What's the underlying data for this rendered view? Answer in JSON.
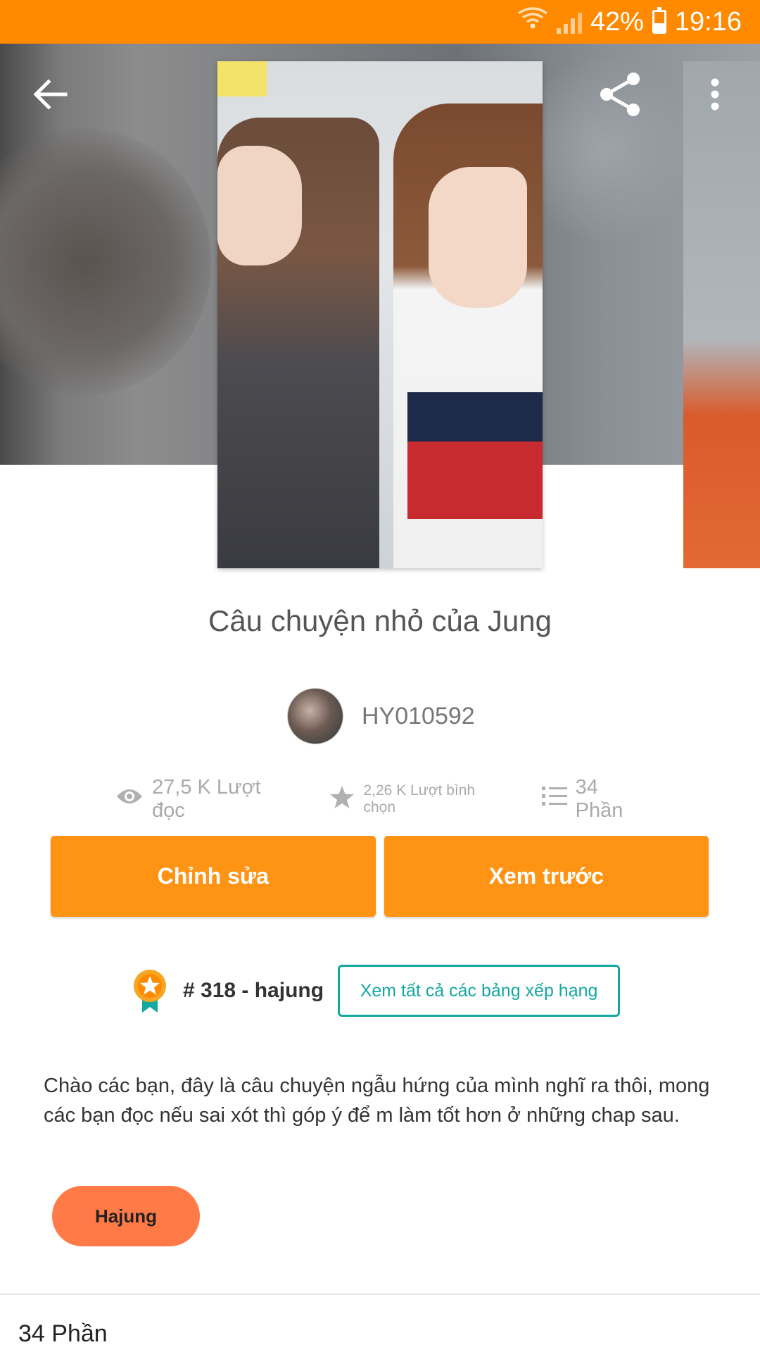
{
  "status_bar": {
    "battery": "42%",
    "time": "19:16",
    "battery_level": 0.42
  },
  "header": {
    "back_icon": "arrow-left-icon",
    "share_icon": "share-icon",
    "more_icon": "more-vert-icon"
  },
  "story": {
    "title": "Câu chuyện nhỏ của Jung",
    "author": "HY010592",
    "reads": "27,5 K Lượt đọc",
    "votes": "2,26 K Lượt bình chọn",
    "parts": "34 Phần",
    "description": "Chào các bạn, đây là câu chuyện ngẫu hứng của mình nghĩ ra thôi, mong các bạn đọc nếu sai xót thì góp ý để m làm tốt hơn ở những chap sau."
  },
  "actions": {
    "edit_label": "Chỉnh sửa",
    "preview_label": "Xem trước"
  },
  "ranking": {
    "rank_text": "# 318 - hajung",
    "view_all_label": "Xem tất cả các bảng xếp hạng"
  },
  "tags": [
    {
      "label": "Hajung"
    }
  ],
  "parts_section": {
    "heading": "34 Phần"
  },
  "colors": {
    "accent": "#ff8a00",
    "button": "#ff9414",
    "teal": "#14a8a0",
    "tag": "#ff7a47"
  }
}
